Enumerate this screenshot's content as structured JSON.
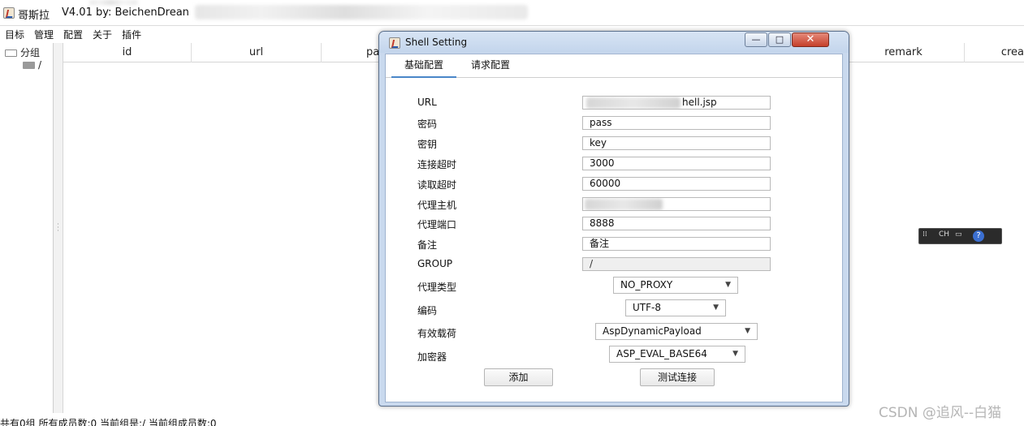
{
  "app": {
    "title": "哥斯拉",
    "version": "V4.01 by: BeichenDrean"
  },
  "menu": [
    "目标",
    "管理",
    "配置",
    "关于",
    "插件"
  ],
  "tree": {
    "root": "分组",
    "child": "/"
  },
  "table": {
    "columns": [
      "id",
      "url",
      "pa",
      "remark",
      "crea"
    ]
  },
  "status": "共有0组 所有成员数:0 当前组是:/ 当前组成员数:0",
  "watermark": "CSDN @追风--白猫",
  "ime": {
    "label": "CH"
  },
  "dialog": {
    "title": "Shell Setting",
    "tabs": [
      "基础配置",
      "请求配置"
    ],
    "fields": {
      "url": {
        "label": "URL",
        "value": "hell.jsp"
      },
      "password": {
        "label": "密码",
        "value": "pass"
      },
      "key": {
        "label": "密钥",
        "value": "key"
      },
      "connect_timeout": {
        "label": "连接超时",
        "value": "3000"
      },
      "read_timeout": {
        "label": "读取超时",
        "value": "60000"
      },
      "proxy_host": {
        "label": "代理主机",
        "value": ""
      },
      "proxy_port": {
        "label": "代理端口",
        "value": "8888"
      },
      "remark": {
        "label": "备注",
        "value": "备注"
      },
      "group": {
        "label": "GROUP",
        "value": "/"
      }
    },
    "selects": {
      "proxy_type": {
        "label": "代理类型",
        "value": "NO_PROXY"
      },
      "encoding": {
        "label": "编码",
        "value": "UTF-8"
      },
      "payload": {
        "label": "有效载荷",
        "value": "AspDynamicPayload"
      },
      "cryption": {
        "label": "加密器",
        "value": "ASP_EVAL_BASE64"
      }
    },
    "buttons": {
      "add": "添加",
      "test": "测试连接"
    },
    "window_controls": {
      "minimize": "—",
      "maximize": "□",
      "close": "✕"
    }
  }
}
